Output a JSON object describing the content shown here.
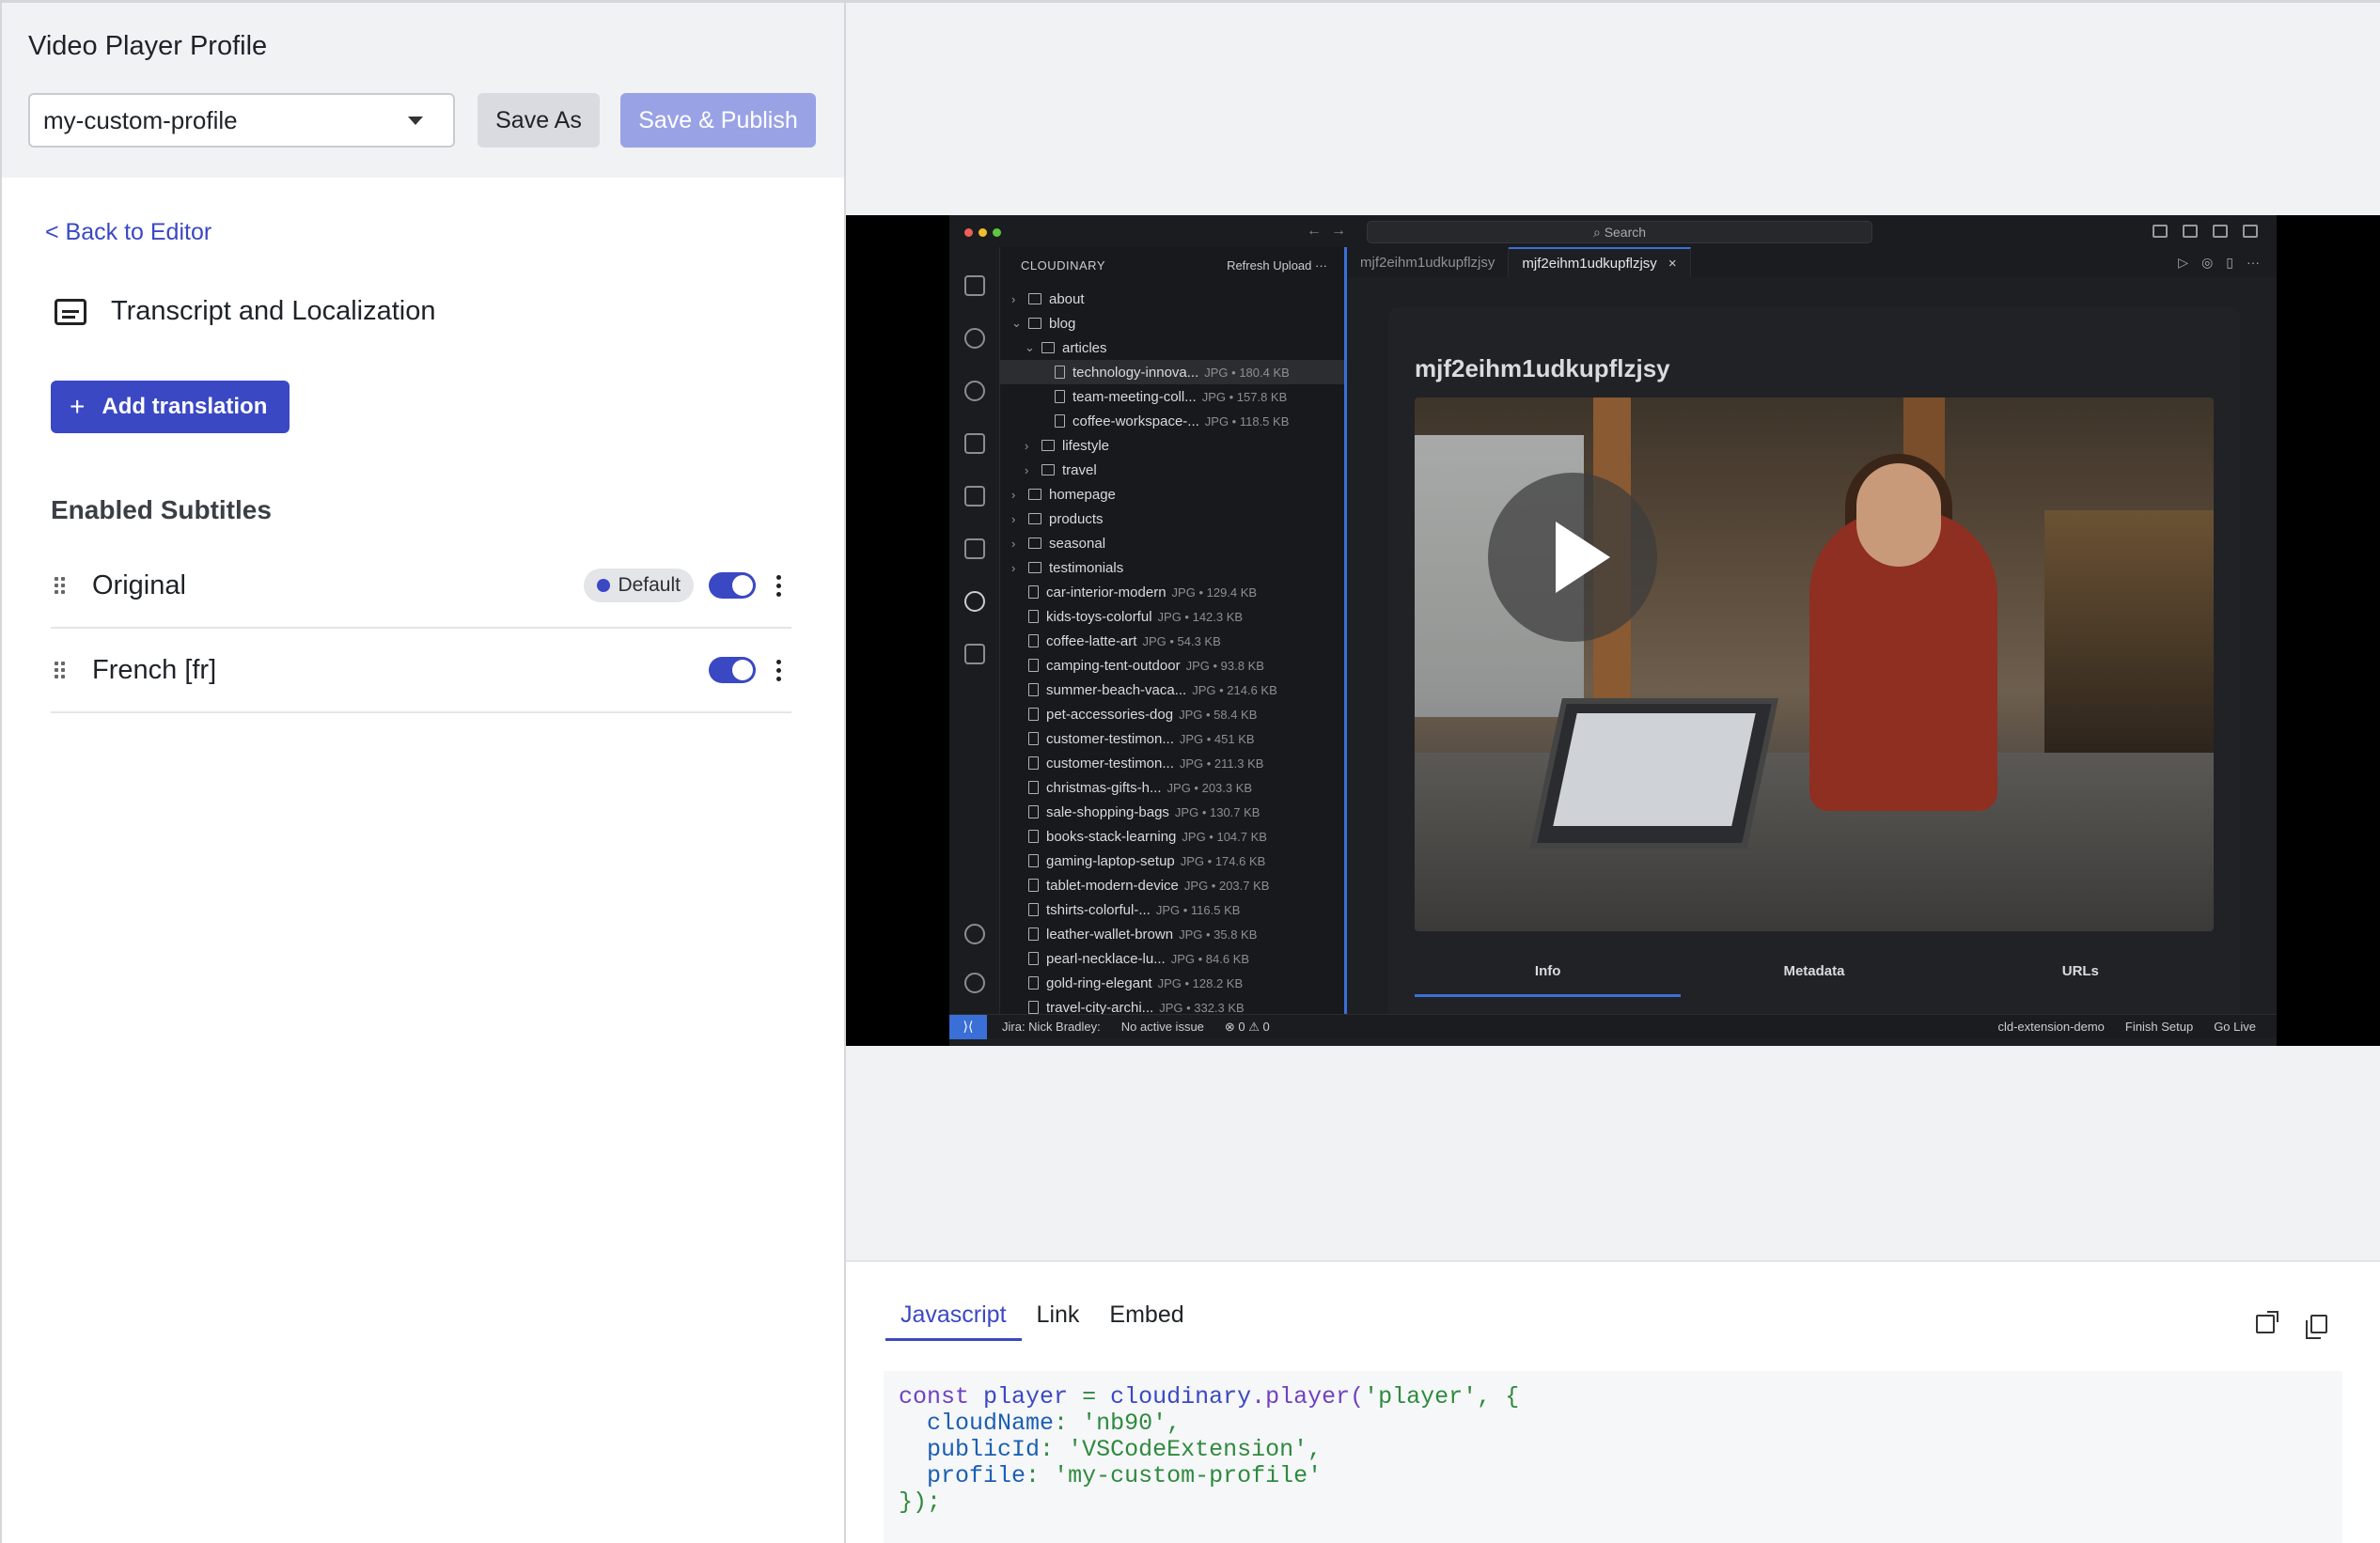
{
  "left_panel": {
    "title": "Video Player Profile",
    "profile_select": {
      "value": "my-custom-profile"
    },
    "save_as_label": "Save As",
    "save_publish_label": "Save & Publish",
    "back_link": "< Back to Editor",
    "section_title": "Transcript and Localization",
    "add_translation_label": "Add translation",
    "enabled_subtitles_title": "Enabled Subtitles",
    "subtitles": [
      {
        "name": "Original",
        "badge": "Default",
        "enabled": true
      },
      {
        "name": "French [fr]",
        "badge": "",
        "enabled": true
      }
    ]
  },
  "preview": {
    "vscode": {
      "search": "Search",
      "explorer_title": "CLOUDINARY",
      "explorer_actions": "Refresh   Upload   ···",
      "tree": [
        {
          "label": "about",
          "kind": "folder",
          "depth": 0
        },
        {
          "label": "blog",
          "kind": "folder-open",
          "depth": 0
        },
        {
          "label": "articles",
          "kind": "folder-open",
          "depth": 1
        },
        {
          "label": "technology-innova...",
          "meta": "JPG • 180.4 KB",
          "kind": "file",
          "depth": 2,
          "selected": true
        },
        {
          "label": "team-meeting-coll...",
          "meta": "JPG • 157.8 KB",
          "kind": "file",
          "depth": 2
        },
        {
          "label": "coffee-workspace-...",
          "meta": "JPG • 118.5 KB",
          "kind": "file",
          "depth": 2
        },
        {
          "label": "lifestyle",
          "kind": "folder",
          "depth": 1
        },
        {
          "label": "travel",
          "kind": "folder",
          "depth": 1
        },
        {
          "label": "homepage",
          "kind": "folder",
          "depth": 0
        },
        {
          "label": "products",
          "kind": "folder",
          "depth": 0
        },
        {
          "label": "seasonal",
          "kind": "folder",
          "depth": 0
        },
        {
          "label": "testimonials",
          "kind": "folder",
          "depth": 0
        },
        {
          "label": "car-interior-modern",
          "meta": "JPG • 129.4 KB",
          "kind": "file",
          "depth": 0
        },
        {
          "label": "kids-toys-colorful",
          "meta": "JPG • 142.3 KB",
          "kind": "file",
          "depth": 0
        },
        {
          "label": "coffee-latte-art",
          "meta": "JPG • 54.3 KB",
          "kind": "file",
          "depth": 0
        },
        {
          "label": "camping-tent-outdoor",
          "meta": "JPG • 93.8 KB",
          "kind": "file",
          "depth": 0
        },
        {
          "label": "summer-beach-vaca...",
          "meta": "JPG • 214.6 KB",
          "kind": "file",
          "depth": 0
        },
        {
          "label": "pet-accessories-dog",
          "meta": "JPG • 58.4 KB",
          "kind": "file",
          "depth": 0
        },
        {
          "label": "customer-testimon...",
          "meta": "JPG • 451 KB",
          "kind": "file",
          "depth": 0
        },
        {
          "label": "customer-testimon...",
          "meta": "JPG • 211.3 KB",
          "kind": "file",
          "depth": 0
        },
        {
          "label": "christmas-gifts-h...",
          "meta": "JPG • 203.3 KB",
          "kind": "file",
          "depth": 0
        },
        {
          "label": "sale-shopping-bags",
          "meta": "JPG • 130.7 KB",
          "kind": "file",
          "depth": 0
        },
        {
          "label": "books-stack-learning",
          "meta": "JPG • 104.7 KB",
          "kind": "file",
          "depth": 0
        },
        {
          "label": "gaming-laptop-setup",
          "meta": "JPG • 174.6 KB",
          "kind": "file",
          "depth": 0
        },
        {
          "label": "tablet-modern-device",
          "meta": "JPG • 203.7 KB",
          "kind": "file",
          "depth": 0
        },
        {
          "label": "tshirts-colorful-...",
          "meta": "JPG • 116.5 KB",
          "kind": "file",
          "depth": 0
        },
        {
          "label": "leather-wallet-brown",
          "meta": "JPG • 35.8 KB",
          "kind": "file",
          "depth": 0
        },
        {
          "label": "pearl-necklace-lu...",
          "meta": "JPG • 84.6 KB",
          "kind": "file",
          "depth": 0
        },
        {
          "label": "gold-ring-elegant",
          "meta": "JPG • 128.2 KB",
          "kind": "file",
          "depth": 0
        },
        {
          "label": "travel-city-archi...",
          "meta": "JPG • 332.3 KB",
          "kind": "file",
          "depth": 0
        }
      ],
      "tabs": [
        {
          "label": "mjf2eihm1udkupflzjsy",
          "active": false
        },
        {
          "label": "mjf2eihm1udkupflzjsy",
          "active": true
        }
      ],
      "asset_title": "mjf2eihm1udkupflzjsy",
      "asset_tabs": [
        "Info",
        "Metadata",
        "URLs"
      ],
      "status": {
        "jira": "Jira: Nick Bradley:",
        "issue": "No active issue",
        "problems": "⊗ 0 ⚠ 0",
        "env": "cld-extension-demo",
        "finish": "Finish Setup",
        "golive": "Go Live"
      }
    }
  },
  "code": {
    "tabs": [
      "Javascript",
      "Link",
      "Embed"
    ],
    "active_tab": "Javascript",
    "snippet": {
      "l1_kw": "const",
      "l1_var": "player",
      "l1_eq": "=",
      "l1_obj": "cloudinary",
      "l1_fn": ".player(",
      "l1_arg": "'player'",
      "l1_end": ", {",
      "cloud_key": "cloudName",
      "cloud_val": "'nb90'",
      "public_key": "publicId",
      "public_val": "'VSCodeExtension'",
      "profile_key": "profile",
      "profile_val": "'my-custom-profile'",
      "close": "});"
    }
  },
  "colors": {
    "accent": "#3a48c4",
    "accent_disabled": "#9aa2e6",
    "panel_bg": "#f1f2f4"
  }
}
